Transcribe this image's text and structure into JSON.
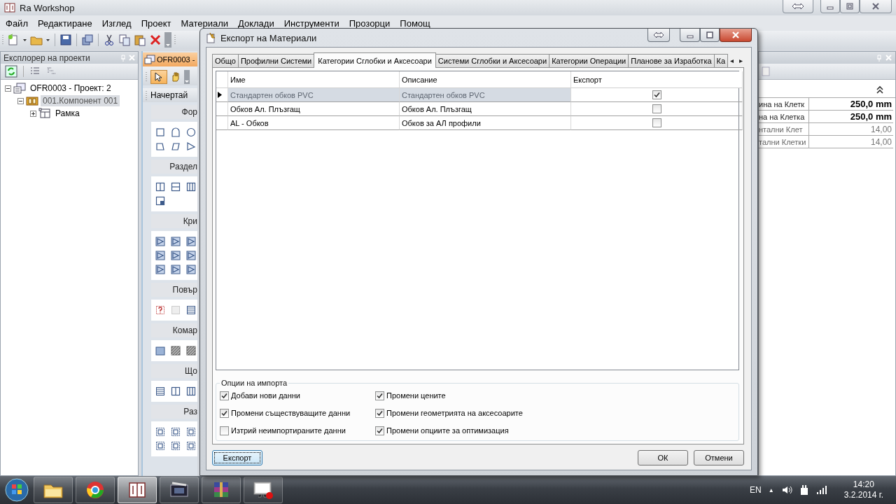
{
  "app": {
    "title": "Ra Workshop"
  },
  "menu": [
    "Файл",
    "Редактиране",
    "Изглед",
    "Проект",
    "Материали",
    "Доклади",
    "Инструменти",
    "Прозорци",
    "Помощ"
  ],
  "explorer": {
    "title": "Експлорер на проекти",
    "tree": [
      {
        "label": "OFR0003 - Проект: 2",
        "expanded": true,
        "selected": false,
        "children": [
          {
            "label": "001.Компонент 001",
            "expanded": true,
            "selected": true,
            "children": [
              {
                "label": "Рамка",
                "expanded": false,
                "selected": false
              }
            ]
          }
        ]
      }
    ]
  },
  "document": {
    "tab": "OFR0003 -",
    "toolbar_tab": "Начертай",
    "sections": [
      "Фор",
      "Раздел",
      "Кри",
      "Повър",
      "Комар",
      "Що",
      "Раз"
    ]
  },
  "properties": {
    "rows": [
      {
        "name": "ина на Клетк",
        "value": "250,0 mm",
        "bold": true
      },
      {
        "name": "на на Клетка",
        "value": "250,0 mm",
        "bold": true
      },
      {
        "name": "нтални Клет",
        "value": "14,00",
        "bold": false
      },
      {
        "name": "тални Клетки",
        "value": "14,00",
        "bold": false
      }
    ]
  },
  "dialog": {
    "title": "Експорт на Материали",
    "tabs": [
      {
        "label": "Общо",
        "selected": false
      },
      {
        "label": "Профилни Системи",
        "selected": false
      },
      {
        "label": "Категории Сглобки и Аксесоари",
        "selected": true
      },
      {
        "label": "Системи Сглобки и Аксесоари",
        "selected": false
      },
      {
        "label": "Категории Операции",
        "selected": false
      },
      {
        "label": "Планове за Изработка",
        "selected": false
      },
      {
        "label": "Ка",
        "selected": false
      }
    ],
    "tab_scroll": [
      "◂",
      "▸"
    ],
    "grid": {
      "columns": [
        "Име",
        "Описание",
        "Експорт"
      ],
      "rows": [
        {
          "name": "Стандартен обков PVC",
          "description": "Стандартен обков PVC",
          "export": true,
          "selected": true
        },
        {
          "name": "Обков Ал. Плъзгащ",
          "description": "Обков Ал. Плъзгащ",
          "export": false,
          "selected": false
        },
        {
          "name": "AL - Обков",
          "description": "Обков за АЛ профили",
          "export": false,
          "selected": false
        }
      ]
    },
    "options": {
      "title": "Опции на импорта",
      "items": [
        {
          "label": "Добави нови данни",
          "checked": true
        },
        {
          "label": "Промени цените",
          "checked": true
        },
        {
          "label": "Промени съществуващите данни",
          "checked": true
        },
        {
          "label": "Промени геометрията на аксесоарите",
          "checked": true
        },
        {
          "label": "Изтрий неимпортираните данни",
          "checked": false
        },
        {
          "label": "Промени опциите за оптимизация",
          "checked": true
        }
      ]
    },
    "buttons": [
      {
        "label": "Експорт",
        "focused": true
      },
      {
        "label": "ОК",
        "focused": false
      },
      {
        "label": "Отмени",
        "focused": false
      }
    ]
  },
  "taskbar": {
    "apps": [
      {
        "kind": "folder",
        "active": false
      },
      {
        "kind": "browser",
        "active": false
      },
      {
        "kind": "book",
        "active": true
      },
      {
        "kind": "film",
        "active": false
      },
      {
        "kind": "archive",
        "active": false
      },
      {
        "kind": "monitor",
        "active": false
      }
    ],
    "language": "EN",
    "tray_arrow": "▲",
    "clock": {
      "time": "14:20",
      "date": "3.2.2014 г."
    }
  }
}
